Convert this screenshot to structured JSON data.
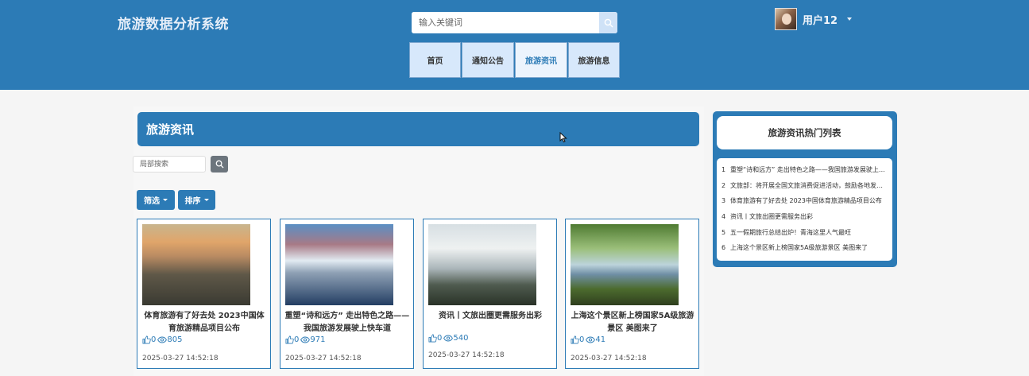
{
  "header": {
    "site_title": "旅游数据分析系统",
    "search_placeholder": "输入关键词",
    "user_name": "用户12"
  },
  "nav": {
    "items": [
      {
        "label": "首页",
        "active": false
      },
      {
        "label": "通知公告",
        "active": false
      },
      {
        "label": "旅游资讯",
        "active": true
      },
      {
        "label": "旅游信息",
        "active": false
      }
    ]
  },
  "main": {
    "section_title": "旅游资讯",
    "local_search_placeholder": "局部搜索",
    "filter_label": "筛选",
    "sort_label": "排序",
    "cards": [
      {
        "title": "体育旅游有了好去处 2023中国体育旅游精品项目公布",
        "likes": "0",
        "views": "805",
        "date": "2025-03-27 14:52:18"
      },
      {
        "title": "重塑“诗和远方” 走出特色之路——我国旅游发展驶上快车道",
        "likes": "0",
        "views": "971",
        "date": "2025-03-27 14:52:18"
      },
      {
        "title": "资讯丨文旅出圈更需服务出彩",
        "likes": "0",
        "views": "540",
        "date": "2025-03-27 14:52:18"
      },
      {
        "title": "上海这个景区新上榜国家5A级旅游景区 美图来了",
        "likes": "0",
        "views": "41",
        "date": "2025-03-27 14:52:18"
      }
    ]
  },
  "sidebar": {
    "title": "旅游资讯热门列表",
    "items": [
      {
        "num": "1",
        "text": "重塑“诗和远方” 走出特色之路——我国旅游发展驶上快车道"
      },
      {
        "num": "2",
        "text": "文旅部：将开展全国文旅消费促进活动，鼓励各地发放消费券"
      },
      {
        "num": "3",
        "text": "体育旅游有了好去处 2023中国体育旅游精品项目公布"
      },
      {
        "num": "4",
        "text": "资讯丨文旅出圈更需服务出彩"
      },
      {
        "num": "5",
        "text": "五一假期旅行总结出炉！青海这里人气最旺"
      },
      {
        "num": "6",
        "text": "上海这个景区新上榜国家5A级旅游景区 美图来了"
      }
    ]
  },
  "colors": {
    "primary": "#2c7bb6",
    "nav_bg": "#d7e8fb",
    "secondary_btn": "#6c757d"
  },
  "icons": {
    "search": "search-icon",
    "like": "thumbs-up-icon",
    "views": "eye-icon",
    "dropdown": "caret-down-icon"
  }
}
